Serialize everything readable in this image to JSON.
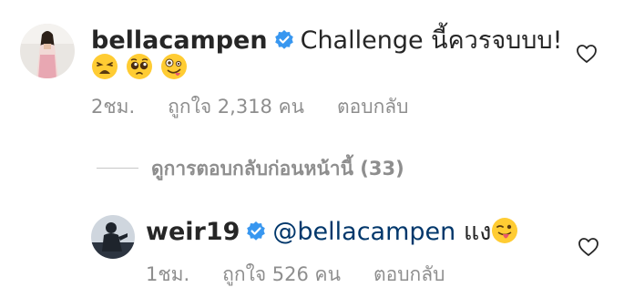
{
  "comments": [
    {
      "username": "bellacampen",
      "text": "Challenge นี้ควรจบบบ!",
      "emojis": [
        "weary-face",
        "pleading-face",
        "zany-face"
      ],
      "time": "2ชม.",
      "likes": "ถูกใจ 2,318 คน",
      "reply_label": "ตอบกลับ"
    },
    {
      "username": "weir19",
      "mention": "@bellacampen",
      "text": "แง",
      "emojis": [
        "winking-face-with-tongue"
      ],
      "time": "1ชม.",
      "likes": "ถูกใจ 526 คน",
      "reply_label": "ตอบกลับ"
    }
  ],
  "view_previous_replies": "ดูการตอบกลับก่อนหน้านี้ (33)",
  "colors": {
    "verified_blue": "#3897f0",
    "muted_text": "#8e8e8e",
    "mention": "#00376b",
    "emoji_yellow": "#ffcc33"
  }
}
